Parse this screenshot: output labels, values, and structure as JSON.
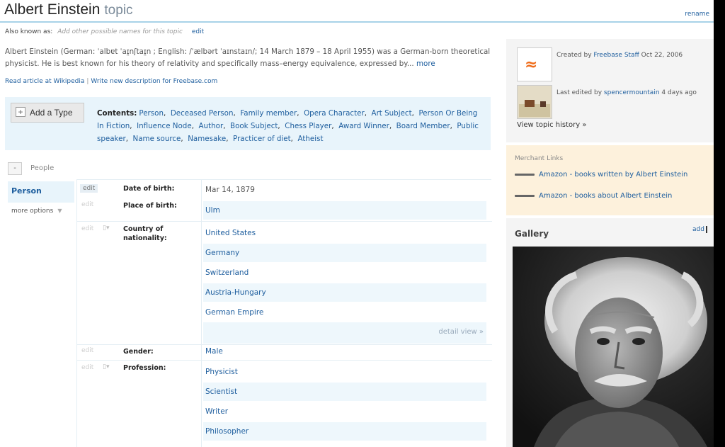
{
  "header": {
    "title": "Albert Einstein",
    "kind": "topic",
    "rename": "rename"
  },
  "aka": {
    "label": "Also known as:",
    "placeholder": "Add other possible names for this topic",
    "edit": "edit"
  },
  "description": {
    "text": "Albert Einstein (German: ˈalbɐt ˈaɪ̯nʃtaɪ̯n ; English: /ˈælbərt ˈaɪnstaɪn/; 14 March 1879 – 18 April 1955) was a German-born theoretical physicist. He is best known for his theory of relativity and specifically mass–energy equivalence, expressed by...",
    "more": "more",
    "read_wikipedia": "Read article at Wikipedia",
    "separator": "|",
    "write_description": "Write new description for Freebase.com"
  },
  "types": {
    "add_type": "Add a Type",
    "contents_label": "Contents:",
    "list": [
      "Person",
      "Deceased Person",
      "Family member",
      "Opera Character",
      "Art Subject",
      "Person Or Being In Fiction",
      "Influence Node",
      "Author",
      "Book Subject",
      "Chess Player",
      "Award Winner",
      "Board Member",
      "Public speaker",
      "Name source",
      "Namesake",
      "Practicer of diet",
      "Atheist"
    ]
  },
  "section": {
    "toggle": "-",
    "label": "People"
  },
  "typenav": {
    "person": "Person",
    "more_options": "more options"
  },
  "properties": {
    "edit": "edit",
    "date_of_birth": {
      "label": "Date of birth:",
      "value": "Mar 14, 1879"
    },
    "place_of_birth": {
      "label": "Place of birth:",
      "value": "Ulm"
    },
    "nationality": {
      "label": "Country of nationality:",
      "values": [
        "United States",
        "Germany",
        "Switzerland",
        "Austria-Hungary",
        "German Empire"
      ]
    },
    "detail_view": "detail view »",
    "gender": {
      "label": "Gender:",
      "value": "Male"
    },
    "profession": {
      "label": "Profession:",
      "values": [
        "Physicist",
        "Scientist",
        "Writer",
        "Philosopher"
      ]
    }
  },
  "meta": {
    "created_prefix": "Created by",
    "created_by": "Freebase Staff",
    "created_date": "Oct 22, 2006",
    "edited_prefix": "Last edited by",
    "edited_by": "spencermountain",
    "edited_date": "4 days ago",
    "history": "View topic history »"
  },
  "merchant": {
    "heading": "Merchant Links",
    "link1": "Amazon - books written by Albert Einstein",
    "link2": "Amazon - books about Albert Einstein"
  },
  "gallery": {
    "heading": "Gallery",
    "add": "add"
  },
  "icons": {
    "freebase": "freebase-logo-icon",
    "editor_avatar": "editor-avatar-icon",
    "merchant": "merchant-link-icon"
  },
  "colors": {
    "link": "#1e5e9e",
    "types_bg": "#e8f4fb",
    "merchant_bg": "#fdf1dc",
    "freebase_orange": "#ef6c1a"
  }
}
